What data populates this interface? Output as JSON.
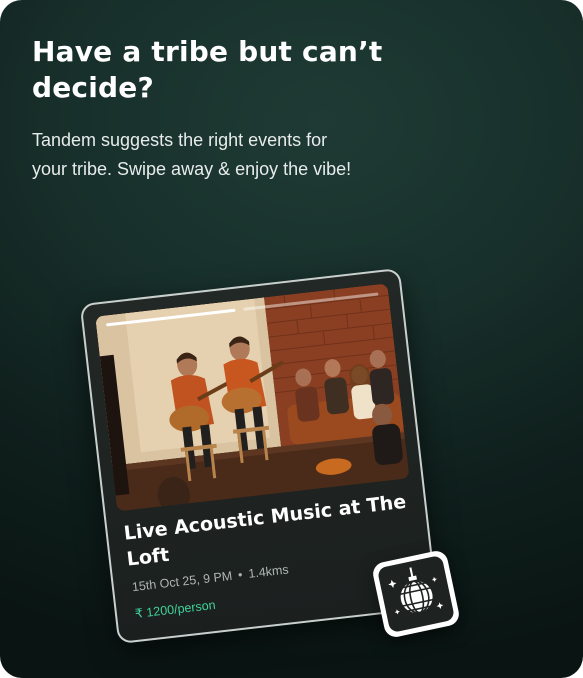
{
  "promo": {
    "headline": "Have a tribe but can’t decide?",
    "subtext": "Tandem suggests the right events for your tribe. Swipe away & enjoy the vibe!"
  },
  "event_card": {
    "title": "Live Acoustic Music at The Loft",
    "date_time": "15th Oct 25, 9 PM",
    "separator": "•",
    "distance": "1.4kms",
    "price": "₹ 1200/person",
    "story_progress_segments": 2,
    "story_progress_active": 1
  },
  "badge": {
    "icon": "disco-ball-icon"
  },
  "colors": {
    "background": "#13251f",
    "accent_green": "#3fd39a",
    "card_bg": "#1f2523"
  }
}
